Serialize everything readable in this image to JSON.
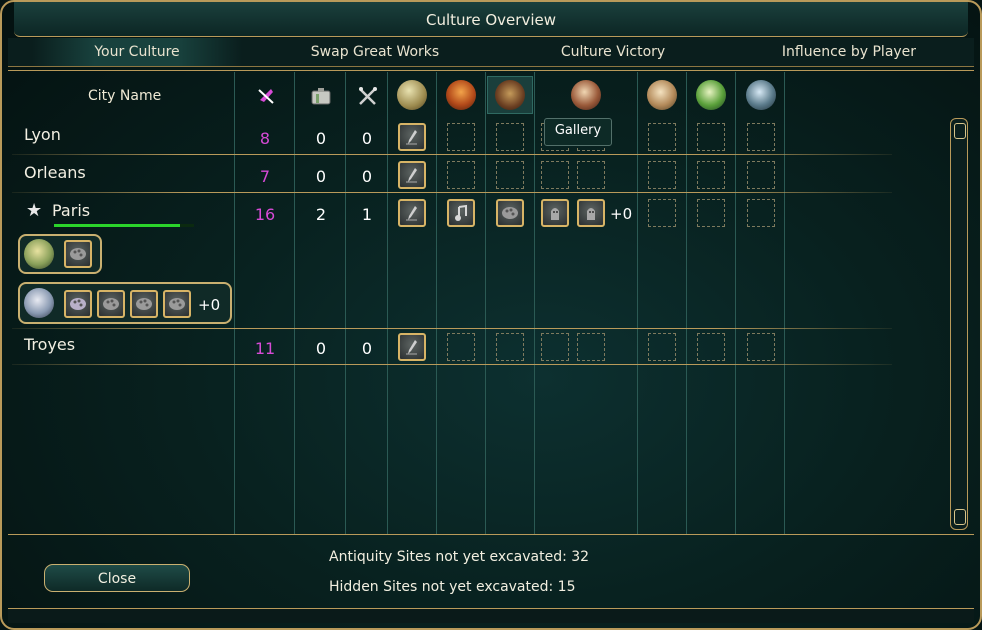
{
  "window": {
    "title": "Culture Overview"
  },
  "tabs": [
    {
      "label": "Your Culture",
      "active": true
    },
    {
      "label": "Swap Great Works",
      "active": false
    },
    {
      "label": "Culture Victory",
      "active": false
    },
    {
      "label": "Influence by Player",
      "active": false
    }
  ],
  "columns": {
    "city_name": "City Name",
    "icons": [
      "tourism-icon",
      "great-works-icon",
      "antiquity-sites-icon",
      "writing-slot-icon",
      "music-slot-icon",
      "art-slot-icon",
      "gallery-icon",
      "wonder-icon-1",
      "wonder-icon-2",
      "wonder-icon-3"
    ]
  },
  "tooltip": "Gallery",
  "cities": [
    {
      "name": "Lyon",
      "tourism": "8",
      "works": "0",
      "sites": "0",
      "capital": false
    },
    {
      "name": "Orleans",
      "tourism": "7",
      "works": "0",
      "sites": "0",
      "capital": false
    },
    {
      "name": "Paris",
      "tourism": "16",
      "works": "2",
      "sites": "1",
      "capital": true,
      "gallery_plus": "+0"
    },
    {
      "name": "Troyes",
      "tourism": "11",
      "works": "0",
      "sites": "0",
      "capital": false
    }
  ],
  "paris_buildings": {
    "row2_plus": "+0"
  },
  "footer": {
    "antiquity": "Antiquity Sites not yet excavated: 32",
    "hidden": "Hidden Sites not yet excavated: 15",
    "close_label": "Close"
  },
  "colors": {
    "gold": "#b99a5a",
    "tourism": "#d64ad6",
    "health": "#2bd42b"
  }
}
